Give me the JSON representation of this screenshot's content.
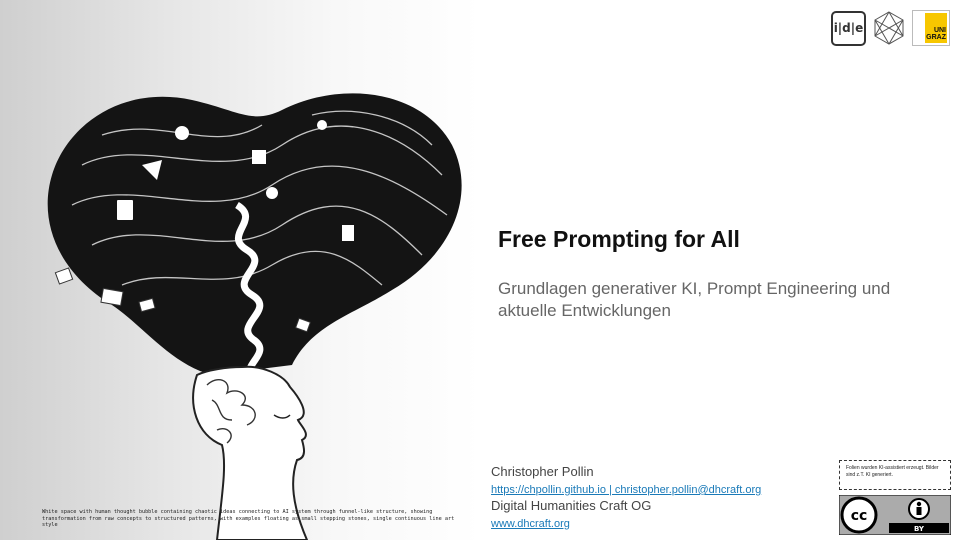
{
  "slide": {
    "title": "Free Prompting for All",
    "subtitle": "Grundlagen generativer KI, Prompt Engineering und aktuelle Entwicklungen",
    "author": {
      "name": "Christopher Pollin",
      "links": "https://chpollin.github.io | christopher.pollin@dhcraft.org",
      "organization": "Digital Humanities Craft OG",
      "org_url": "www.dhcraft.org"
    },
    "image_caption": "White space with human thought bubble containing chaotic ideas connecting to AI system through funnel-like structure, showing transformation from raw concepts to structured patterns, with examples floating as small stepping stones, single continuous line art style",
    "cc_note": "Folien wurden KI-assistiert erzeugt. Bilder sind z.T. KI generiert.",
    "license": "BY",
    "logos": {
      "idle": "i|d|e",
      "uni": "UNI GRAZ"
    }
  },
  "colors": {
    "accent_link": "#1a7ab8",
    "uni_yellow": "#f7c700",
    "title": "#111111",
    "subtitle": "#666666"
  }
}
